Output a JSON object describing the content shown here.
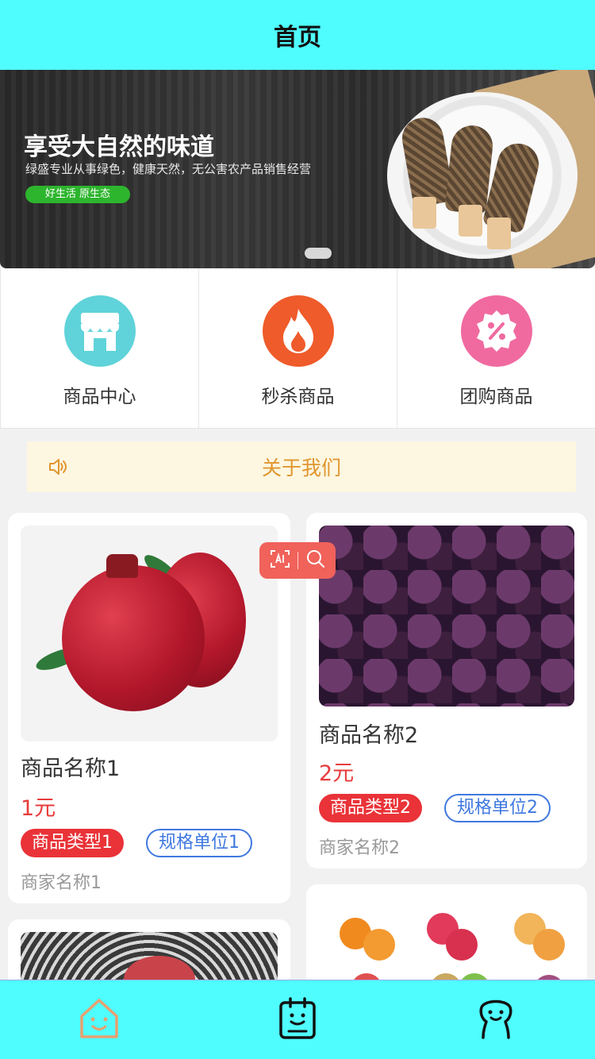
{
  "header": {
    "title": "首页"
  },
  "banner": {
    "headline": "享受大自然的味道",
    "subline": "绿盛专业从事绿色，健康天然，无公害农产品销售经营",
    "pill": "好生活 原生态"
  },
  "categories": [
    {
      "label": "商品中心",
      "icon": "shop-icon",
      "color": "#5fd3d9"
    },
    {
      "label": "秒杀商品",
      "icon": "fire-icon",
      "color": "#ef5b2b"
    },
    {
      "label": "团购商品",
      "icon": "discount-icon",
      "color": "#f06aa0"
    }
  ],
  "notice": {
    "text": "关于我们",
    "icon": "speaker-icon"
  },
  "products": [
    {
      "name": "商品名称1",
      "price": "1元",
      "type": "商品类型1",
      "unit": "规格单位1",
      "seller": "商家名称1",
      "image": "pomegranate"
    },
    {
      "name": "商品名称2",
      "price": "2元",
      "type": "商品类型2",
      "unit": "规格单位2",
      "seller": "商家名称2",
      "image": "mangosteen"
    }
  ],
  "tabbar": [
    {
      "icon": "home-icon",
      "active": true
    },
    {
      "icon": "clipboard-icon",
      "active": false
    },
    {
      "icon": "user-icon",
      "active": false
    }
  ],
  "colors": {
    "header_bg": "#4ffcfe",
    "price": "#e83b3b",
    "tag_red": "#e93338",
    "tag_blue": "#3f78e0",
    "notice_text": "#e0962e"
  }
}
